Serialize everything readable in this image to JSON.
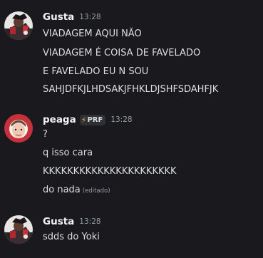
{
  "messages": [
    {
      "author": "Gusta",
      "timestamp": "13:28",
      "avatar": "gusta-avatar",
      "lines": [
        "VIADAGEM AQUI NÃO",
        "VIADAGEM É COISA DE FAVELADO",
        "E FAVELADO EU N SOU",
        "SAHJDFKJLHDSAKJFHKLDJSHFSDAHFJK"
      ]
    },
    {
      "author": "peaga",
      "timestamp": "13:28",
      "avatar": "peaga-avatar",
      "tag": {
        "icon": "lightning-icon",
        "label": "PRF"
      },
      "lines": [
        "?",
        "q isso cara",
        "KKKKKKKKKKKKKKKKKKKKKK",
        "do nada"
      ],
      "edited_label": "(editado)"
    },
    {
      "author": "Gusta",
      "timestamp": "13:28",
      "avatar": "gusta-avatar",
      "lines": [
        "sdds do Yoki"
      ]
    }
  ],
  "colors": {
    "background": "#1a1a1e",
    "username": "#f2f3f5",
    "text": "#dbdee1",
    "muted": "#949ba4",
    "tag_icon": "#f0b232"
  }
}
